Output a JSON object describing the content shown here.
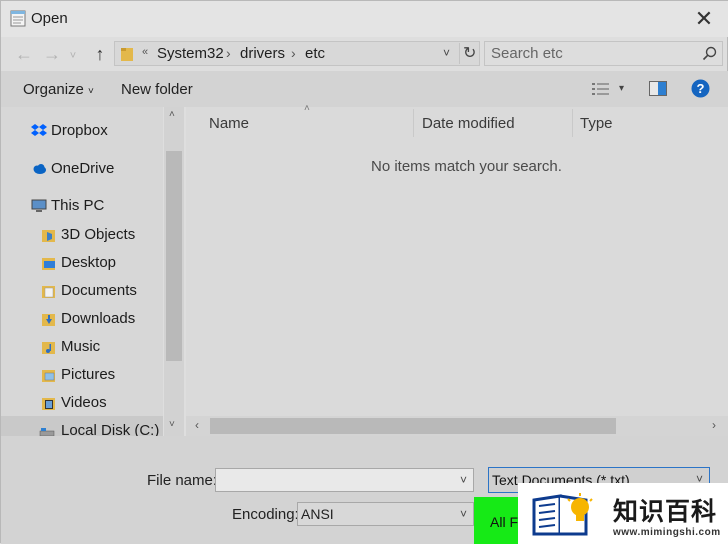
{
  "window": {
    "title": "Open"
  },
  "address": {
    "crumbs": [
      "System32",
      "drivers",
      "etc"
    ]
  },
  "search": {
    "placeholder": "Search etc"
  },
  "toolbar": {
    "organize": "Organize",
    "organize_caret": "˅",
    "new_folder": "New folder"
  },
  "nav": {
    "items": [
      {
        "label": "Dropbox",
        "icon": "dropbox-icon"
      },
      {
        "label": "OneDrive",
        "icon": "cloud-icon"
      },
      {
        "label": "This PC",
        "icon": "computer-icon"
      },
      {
        "label": "3D Objects",
        "icon": "folder-3d-icon"
      },
      {
        "label": "Desktop",
        "icon": "desktop-folder-icon"
      },
      {
        "label": "Documents",
        "icon": "documents-folder-icon"
      },
      {
        "label": "Downloads",
        "icon": "downloads-folder-icon"
      },
      {
        "label": "Music",
        "icon": "music-folder-icon"
      },
      {
        "label": "Pictures",
        "icon": "pictures-folder-icon"
      },
      {
        "label": "Videos",
        "icon": "videos-folder-icon"
      },
      {
        "label": "Local Disk (C:)",
        "icon": "disk-icon"
      }
    ]
  },
  "list": {
    "columns": [
      "Name",
      "Date modified",
      "Type"
    ],
    "empty_message": "No items match your search."
  },
  "bottom": {
    "file_name_label": "File name:",
    "file_name_value": "",
    "file_type_value": "Text Documents (*.txt)",
    "encoding_label": "Encoding:",
    "encoding_value": "ANSI",
    "all_files_option": "All Fi"
  },
  "watermark": {
    "title": "知识百科",
    "url": "www.mimingshi.com"
  },
  "colors": {
    "accent": "#0078d7",
    "help": "#1565c0",
    "highlight": "#16ea16",
    "folder": "#e8b84a"
  }
}
